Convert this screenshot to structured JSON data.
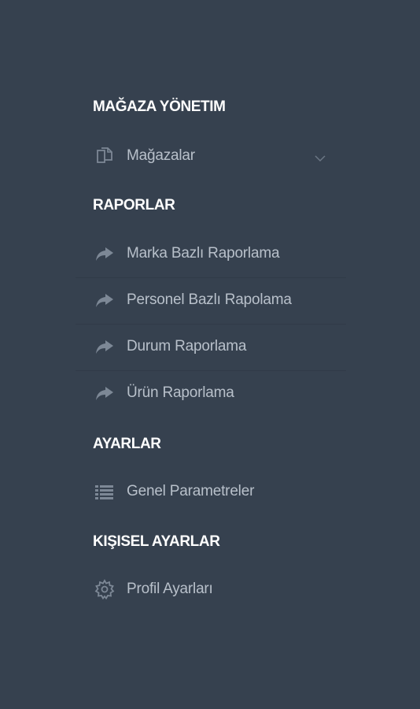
{
  "sections": {
    "store": {
      "title": "MAĞAZA YÖNETIM",
      "items": [
        {
          "label": "Mağazalar",
          "icon": "copy-icon"
        }
      ]
    },
    "reports": {
      "title": "RAPORLAR",
      "items": [
        {
          "label": "Marka Bazlı Raporlama",
          "icon": "share-arrow-icon"
        },
        {
          "label": "Personel Bazlı Rapolama",
          "icon": "share-arrow-icon"
        },
        {
          "label": "Durum Raporlama",
          "icon": "share-arrow-icon"
        },
        {
          "label": "Ürün Raporlama",
          "icon": "share-arrow-icon"
        }
      ]
    },
    "settings": {
      "title": "AYARLAR",
      "items": [
        {
          "label": "Genel Parametreler",
          "icon": "list-icon"
        }
      ]
    },
    "personal": {
      "title": "KIŞISEL AYARLAR",
      "items": [
        {
          "label": "Profil Ayarları",
          "icon": "gear-icon"
        }
      ]
    }
  },
  "colors": {
    "background": "#36414f",
    "title": "#ffffff",
    "item_text": "#b8c0ca",
    "icon": "#7d8896"
  }
}
